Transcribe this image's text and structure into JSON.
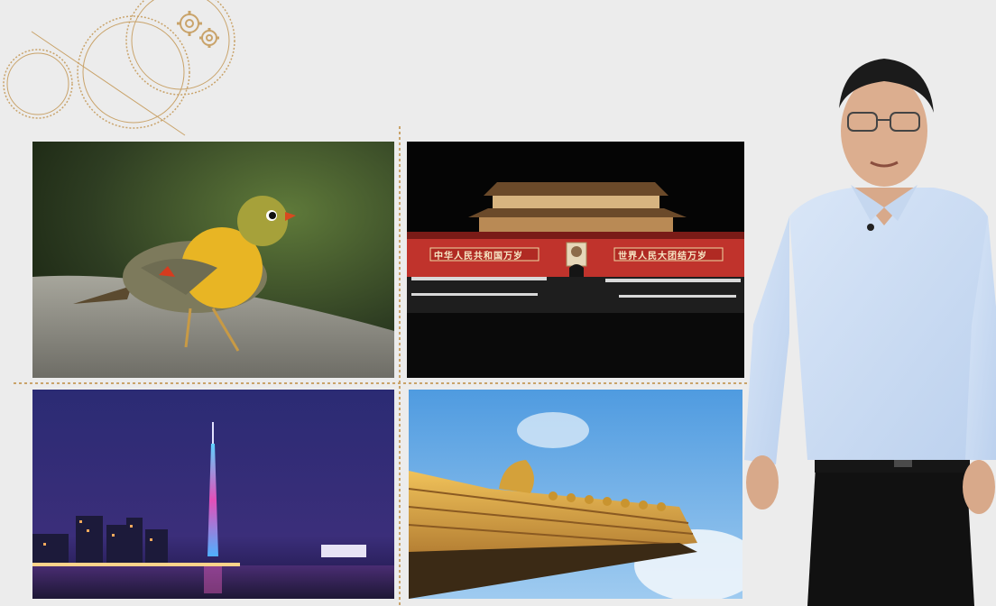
{
  "slide": {
    "background": "#ececec",
    "accent": "#c9a36a"
  },
  "photos": {
    "bird": {
      "subject": "yellow-breasted bird on rock"
    },
    "tiananmen": {
      "banner_left": "中华人民共和国万岁",
      "banner_right": "世界人民大团结万岁",
      "wall_color": "#c0332c"
    },
    "canton_tower": {
      "subject": "lit tower over river at night"
    },
    "palace_roof": {
      "subject": "golden glazed-tile roof against blue sky"
    }
  },
  "icons": {
    "gears": "gear-icon",
    "circles": "decorative-circles-icon"
  }
}
